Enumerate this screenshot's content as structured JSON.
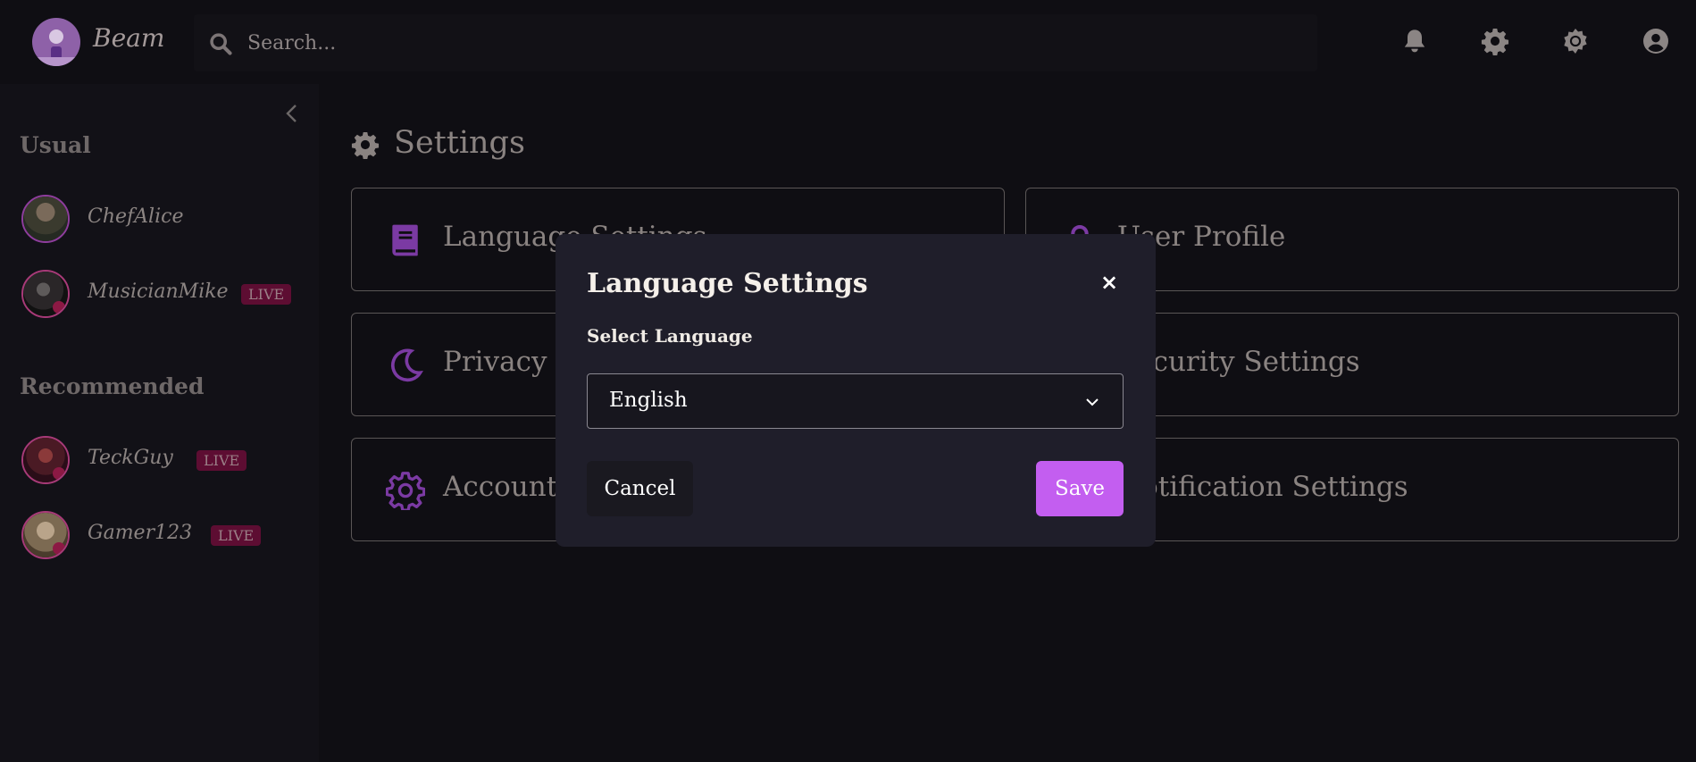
{
  "header": {
    "brand": "Beam",
    "search_placeholder": "Search..."
  },
  "sidebar": {
    "usual_title": "Usual",
    "recommended_title": "Recommended",
    "usual": [
      {
        "name": "ChefAlice",
        "live": false
      },
      {
        "name": "MusicianMike",
        "live": true,
        "badge": "LIVE"
      }
    ],
    "recommended": [
      {
        "name": "TeckGuy",
        "live": true,
        "badge": "LIVE"
      },
      {
        "name": "Gamer123",
        "live": true,
        "badge": "LIVE"
      }
    ]
  },
  "main": {
    "title": "Settings",
    "cards": [
      {
        "label": "Language Settings",
        "icon": "book-icon"
      },
      {
        "label": "User Profile",
        "icon": "user-icon"
      },
      {
        "label": "Privacy Settings",
        "icon": "moon-icon"
      },
      {
        "label": "Security Settings",
        "icon": "lock-icon"
      },
      {
        "label": "Account Settings",
        "icon": "gear-icon"
      },
      {
        "label": "Notification Settings",
        "icon": "bell-icon"
      }
    ]
  },
  "modal": {
    "title": "Language Settings",
    "close": "×",
    "select_label": "Select Language",
    "selected_language": "English",
    "cancel": "Cancel",
    "save": "Save"
  },
  "colors": {
    "accent": "#c35ef0",
    "live_badge": "#5d0d32",
    "icon_purple": "#7b3aa3"
  }
}
